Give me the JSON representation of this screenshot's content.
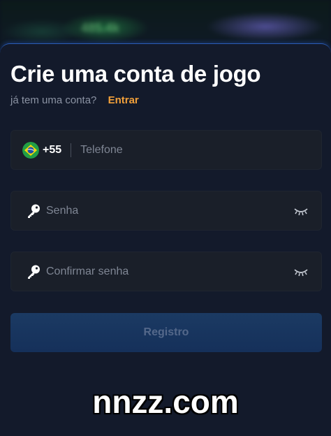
{
  "form": {
    "title": "Crie uma conta de jogo",
    "has_account_text": "já tem uma conta?",
    "login_link": "Entrar",
    "phone": {
      "country_icon": "brazil-flag-icon",
      "country_code": "+55",
      "placeholder": "Telefone",
      "value": ""
    },
    "password": {
      "icon": "key-icon",
      "placeholder": "Senha",
      "value": "",
      "toggle_icon": "eye-closed-icon"
    },
    "confirm_password": {
      "icon": "key-icon",
      "placeholder": "Confirmar senha",
      "value": "",
      "toggle_icon": "eye-closed-icon"
    },
    "submit_label": "Registro"
  },
  "watermark": "nnzz.com",
  "background_blur_text": "485.4k",
  "colors": {
    "accent_link": "#f2a03a",
    "sheet_bg": "#131a2b",
    "field_bg": "#1a1f29",
    "button_bg": "#1b3a63",
    "button_text": "#54688a",
    "border_glow": "#2b5db8"
  }
}
